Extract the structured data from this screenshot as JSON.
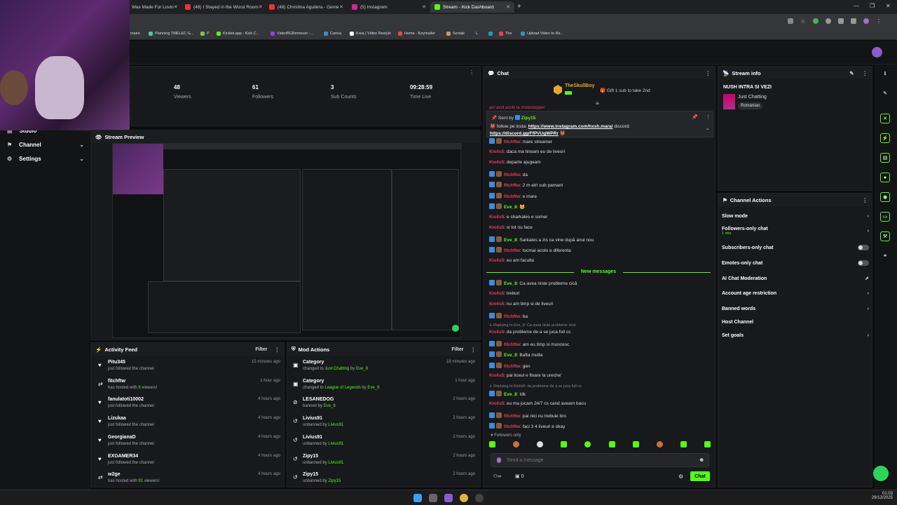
{
  "browser": {
    "tabs": [
      {
        "title": "Was Made For Lovin",
        "color": "#e33"
      },
      {
        "title": "(46) I Stayed in the Worst Room",
        "color": "#e33"
      },
      {
        "title": "(48) Christina Aguilera - Genie",
        "color": "#e33"
      },
      {
        "title": "(5) Instagram",
        "color": "#d6249f"
      },
      {
        "title": "Stream - Kick Dashboard",
        "color": "#53fc18"
      }
    ],
    "bookmarks": [
      "maire",
      "Planning TMELEC G...",
      "P",
      "Kicklet.app - Kick C...",
      "VideoBGRemover -...",
      "Canva",
      "Krea | Video Restyle",
      "Home - Keymailer",
      "Seriale",
      "L",
      "The",
      "Upload Video to Re..."
    ]
  },
  "sidebar": {
    "items": [
      {
        "label": "Studio"
      },
      {
        "label": "Channel"
      },
      {
        "label": "Settings"
      }
    ]
  },
  "stats": [
    {
      "value": "48",
      "label": "Viewers"
    },
    {
      "value": "61",
      "label": "Followers"
    },
    {
      "value": "3",
      "label": "Sub Counts"
    },
    {
      "value": "09:28:59",
      "label": "Time Live"
    }
  ],
  "stream_preview": {
    "title": "Stream Preview"
  },
  "activity_feed": {
    "title": "Activity Feed",
    "filter": "Filter",
    "items": [
      {
        "name": "Pitu345",
        "desc": "just followed the channel",
        "time": "15 minutes ago",
        "icon": "heart"
      },
      {
        "name": "fitchftw",
        "desc": "has hosted with ",
        "num": "8",
        "desc2": " viewers!",
        "time": "1 hour ago",
        "icon": "host"
      },
      {
        "name": "fanulatoti10002",
        "desc": "just followed the channel",
        "time": "4 hours ago",
        "icon": "heart"
      },
      {
        "name": "Lizukaa",
        "desc": "just followed the channel",
        "time": "4 hours ago",
        "icon": "heart"
      },
      {
        "name": "GeorgianaD",
        "desc": "just followed the channel",
        "time": "4 hours ago",
        "icon": "heart"
      },
      {
        "name": "EXGAMER34",
        "desc": "just followed the channel",
        "time": "4 hours ago",
        "icon": "heart"
      },
      {
        "name": "w2ge",
        "desc": "has hosted with ",
        "num": "91",
        "desc2": " viewers!",
        "time": "4 hours ago",
        "icon": "host"
      }
    ]
  },
  "mod_actions": {
    "title": "Mod Actions",
    "filter": "Filter",
    "items": [
      {
        "name": "Category",
        "desc": "changed to ",
        "hl": "Just Chatting",
        "by": " by ",
        "user": "Eve_8",
        "time": "18 minutes ago"
      },
      {
        "name": "Category",
        "desc": "changed to ",
        "hl": "League of Legends",
        "by": " by ",
        "user": "Eve_8",
        "time": "1 hour ago"
      },
      {
        "name": "LESANEDOG",
        "desc": "banned by ",
        "hl": "Eve_8",
        "by": "",
        "user": "",
        "time": "2 hours ago"
      },
      {
        "name": "Livius91",
        "desc": "unbanned by ",
        "hl": "Livius91",
        "by": "",
        "user": "",
        "time": "2 hours ago"
      },
      {
        "name": "Livius91",
        "desc": "unbanned by ",
        "hl": "Livius91",
        "by": "",
        "user": "",
        "time": "2 hours ago"
      },
      {
        "name": "Zipy15",
        "desc": "unbanned by ",
        "hl": "Livius91",
        "by": "",
        "user": "",
        "time": "2 hours ago"
      },
      {
        "name": "Zipy15",
        "desc": "unbanned by ",
        "hl": "Zipy15",
        "by": "",
        "user": "",
        "time": "2 hours ago"
      }
    ]
  },
  "chat": {
    "title": "Chat",
    "gifter": "TheSkullBoy",
    "gift_text": "Gift 1 sub to take 2nd",
    "pinned_by": "Sent by",
    "pinned_user": "Zipy15",
    "pinned_text": "follow pe insta: ",
    "pinned_link1": "https://www.instagram.com/hxsh.mara/",
    "pinned_text2": " discord: ",
    "pinned_link2": "https://discord.gg/FfPVUgWPRr",
    "partial_top": "am avut acolo la showstopper",
    "new_messages": "New messages",
    "followers_only": "Followers only",
    "input_placeholder": "Send a message",
    "send": "Chat",
    "viewers_count": "0",
    "messages": [
      {
        "user": "fitchftw",
        "text": ": mare streamer",
        "color": "#e0405a",
        "badges": 2
      },
      {
        "user": "Kiolis5",
        "text": ": daca ma tineam eu de liveuri",
        "color": "#e0405a",
        "badges": 0
      },
      {
        "user": "Kiolis5",
        "text": ": departe ajugeam",
        "color": "#e0405a",
        "badges": 0
      },
      {
        "user": "fitchftw",
        "text": ": da",
        "color": "#e0405a",
        "badges": 2
      },
      {
        "user": "fitchftw",
        "text": ": 2 m etri sub pamant",
        "color": "#e0405a",
        "badges": 2
      },
      {
        "user": "fitchftw",
        "text": ": e mare",
        "color": "#e0405a",
        "badges": 2
      },
      {
        "user": "Eve_8",
        "text": ": 🐱",
        "color": "#53fc18",
        "badges": 2
      },
      {
        "user": "Kiolis5",
        "text": ": e sharkales e somer",
        "color": "#e0405a",
        "badges": 0
      },
      {
        "user": "Kiolis5",
        "text": ": si tot nu face",
        "color": "#e0405a",
        "badges": 0
      },
      {
        "user": "Eve_8",
        "text": ": Sarkales a zis ca vine după anul nou",
        "color": "#53fc18",
        "badges": 2
      },
      {
        "user": "fitchftw",
        "text": ": tocmai acolo e diferenta",
        "color": "#e0405a",
        "badges": 2
      },
      {
        "user": "Kiolis5",
        "text": ": eu am faculta",
        "color": "#e0405a",
        "badges": 0
      },
      {
        "user": "Eve_8",
        "text": ": Ca avea niste probleme cică",
        "color": "#53fc18",
        "badges": 2
      },
      {
        "user": "Kiolis5",
        "text": ": treburi",
        "color": "#e0405a",
        "badges": 0
      },
      {
        "user": "Kiolis5",
        "text": ": nu am timp si de liveuri",
        "color": "#e0405a",
        "badges": 0
      },
      {
        "user": "fitchftw",
        "text": ": ba",
        "color": "#e0405a",
        "badges": 2
      },
      {
        "reply": "Replying to Eve_8: Ca avea niste probleme cică",
        "user": "Kiolis5",
        "text": ": da probleme de a se juca full cs",
        "color": "#e0405a",
        "badges": 0
      },
      {
        "user": "fitchftw",
        "text": ": am eu timp si muncesc",
        "color": "#e0405a",
        "badges": 2
      },
      {
        "user": "Eve_8",
        "text": ": Bafta multa",
        "color": "#53fc18",
        "badges": 2
      },
      {
        "user": "fitchftw",
        "text": ": gen",
        "color": "#e0405a",
        "badges": 2
      },
      {
        "user": "Kiolis5",
        "text": ": pai liceul e floare la ureche'",
        "color": "#e0405a",
        "badges": 0
      },
      {
        "reply": "Replying to Kiolis5: da probleme de a se juca full cs",
        "user": "Eve_8",
        "text": ": Idk",
        "color": "#53fc18",
        "badges": 2
      },
      {
        "user": "Kiolis5",
        "text": ": eu ma jucam 24/7 cs cand aveam bacu",
        "color": "#e0405a",
        "badges": 0
      },
      {
        "user": "fitchftw",
        "text": ": pai nici nu trebuie bro",
        "color": "#e0405a",
        "badges": 2
      },
      {
        "user": "fitchftw",
        "text": ": faci 3 4 liveuri e okay",
        "color": "#e0405a",
        "badges": 2
      }
    ]
  },
  "stream_info": {
    "title": "Stream info",
    "stream_title": "NUSH INTRA SI VEZI",
    "category": "Just Chatting",
    "tag": "Romanian"
  },
  "channel_actions": {
    "title": "Channel Actions",
    "items": [
      {
        "label": "Slow mode",
        "control": "chevron"
      },
      {
        "label": "Followers-only chat",
        "sub": "1 min",
        "control": "chevron"
      },
      {
        "label": "Subscribers-only chat",
        "control": "toggle"
      },
      {
        "label": "Emotes-only chat",
        "control": "toggle"
      },
      {
        "label": "AI Chat Moderation",
        "control": "external"
      },
      {
        "label": "Account age restriction",
        "control": "chevron"
      },
      {
        "label": "Banned words",
        "control": "chevron"
      },
      {
        "label": "Host Channel",
        "control": "none"
      },
      {
        "label": "Set goals",
        "control": "chevron"
      }
    ]
  },
  "taskbar": {
    "time": "01:03",
    "date": "29/12/2025"
  },
  "colors": {
    "accent": "#53fc18",
    "panel": "#17191c",
    "bg": "#0b0d0f"
  }
}
